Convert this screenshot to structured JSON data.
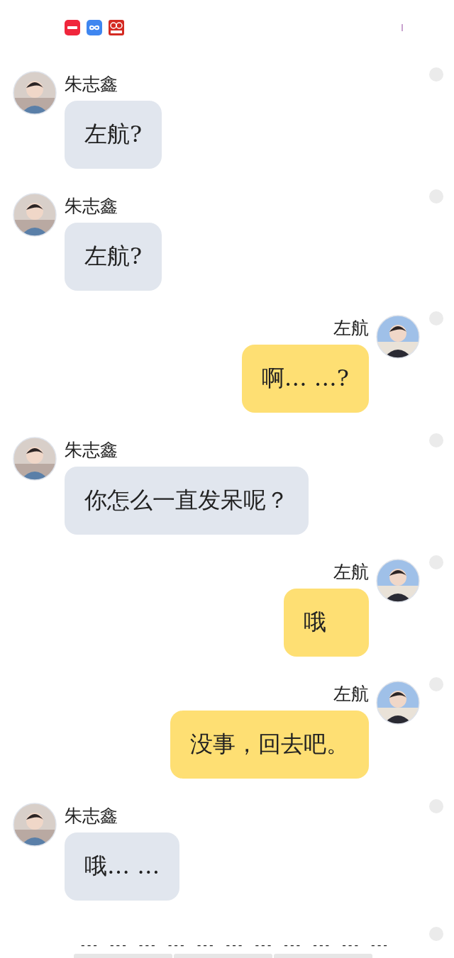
{
  "status_bar": {
    "apps": [
      {
        "kind": "red"
      },
      {
        "kind": "blue"
      },
      {
        "kind": "pattern"
      }
    ]
  },
  "messages": [
    {
      "kind": "incoming",
      "sender": "朱志鑫",
      "text": "左航?",
      "selected": false
    },
    {
      "kind": "incoming",
      "sender": "朱志鑫",
      "text": "左航?",
      "selected": false
    },
    {
      "kind": "outgoing",
      "sender": "左航",
      "text": "啊… …?",
      "selected": false
    },
    {
      "kind": "incoming",
      "sender": "朱志鑫",
      "text": "你怎么一直发呆呢？",
      "selected": false
    },
    {
      "kind": "outgoing",
      "sender": "左航",
      "text": "哦",
      "selected": false
    },
    {
      "kind": "outgoing",
      "sender": "左航",
      "text": "没事，回去吧。",
      "selected": false
    },
    {
      "kind": "incoming",
      "sender": "朱志鑫",
      "text": "哦… …",
      "selected": false
    }
  ],
  "footer": {
    "dashes": [
      "---",
      "---",
      "---",
      "---",
      "---",
      "---",
      "---",
      "---",
      "---",
      "---",
      "---"
    ],
    "selected": false
  }
}
